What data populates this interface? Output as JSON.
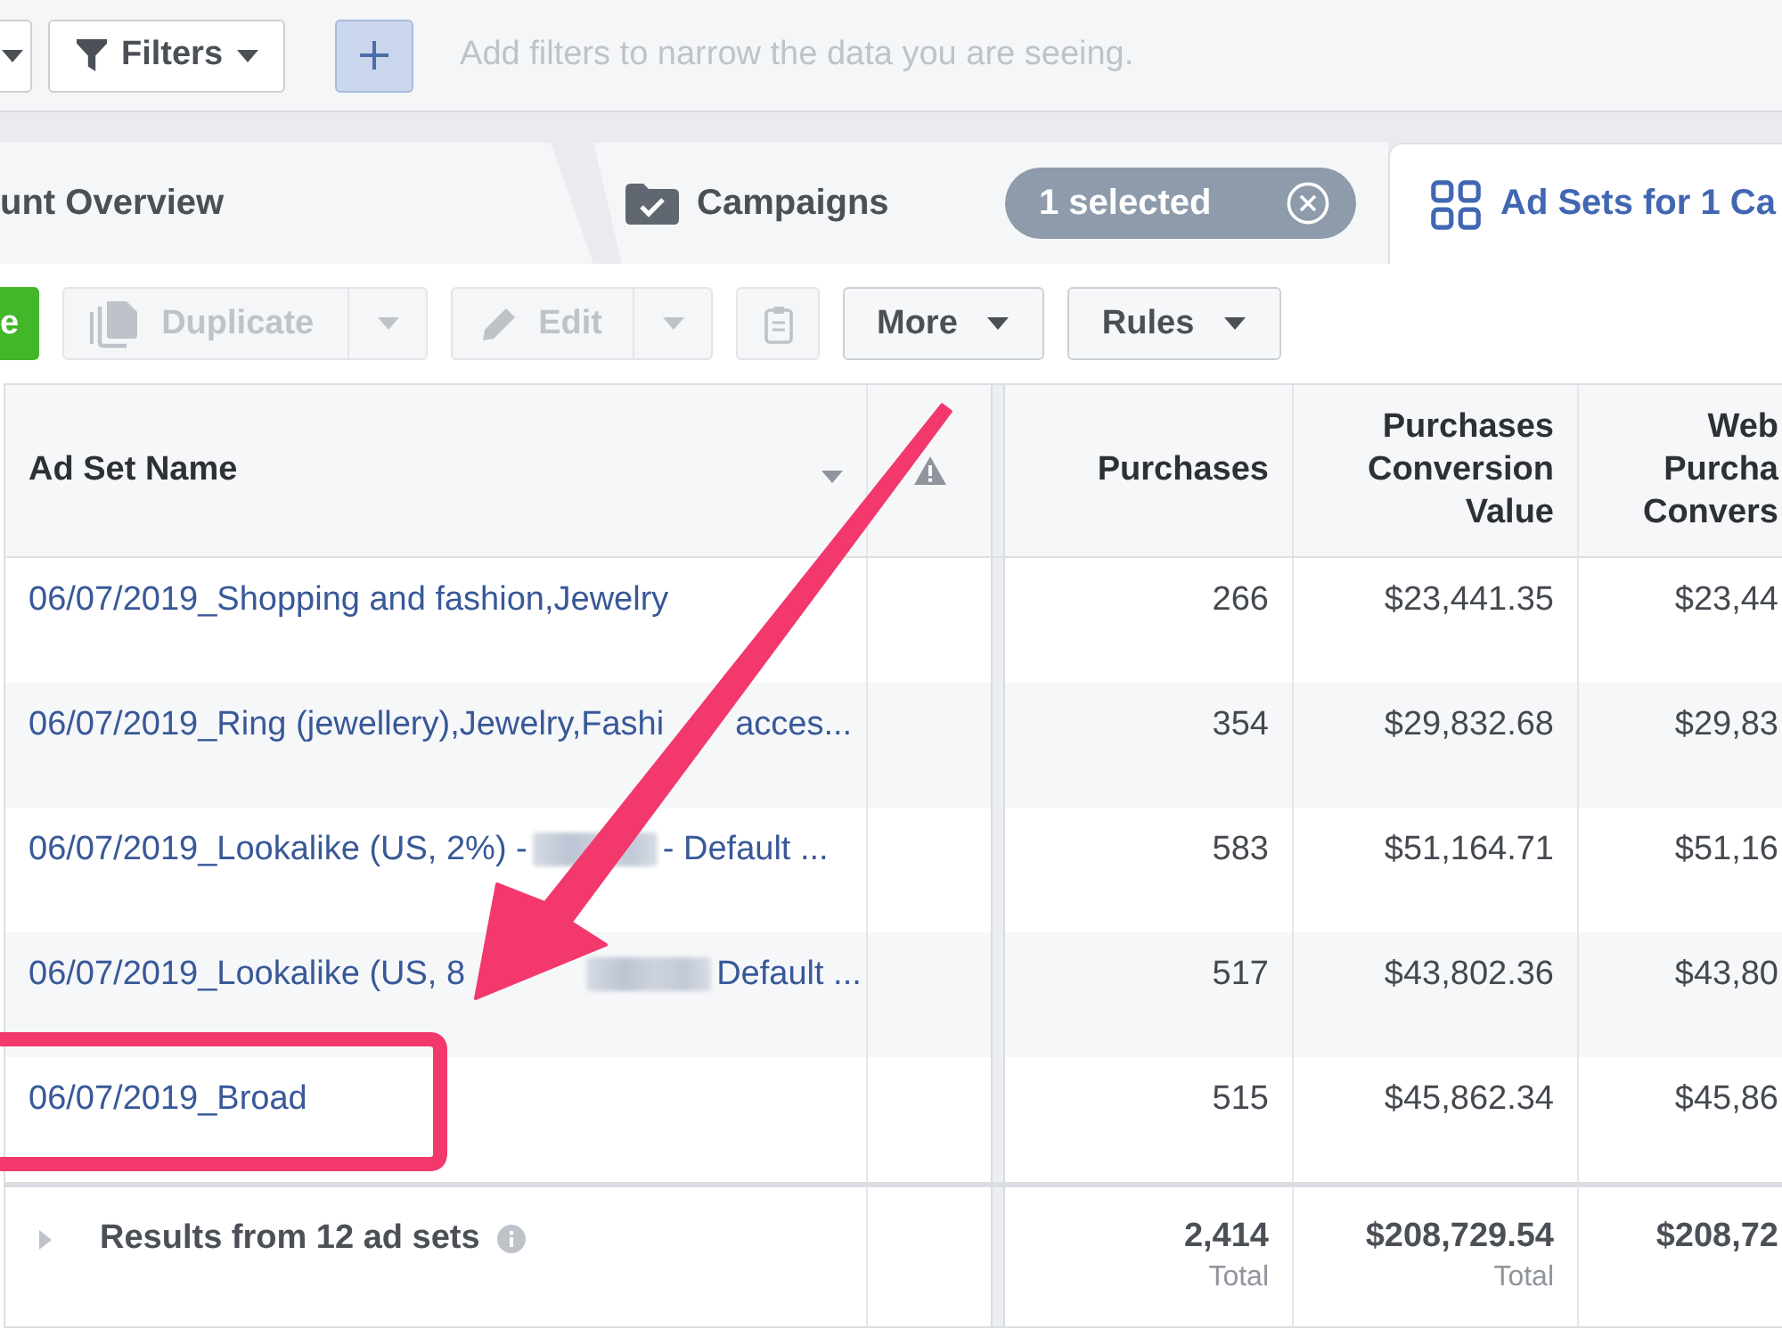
{
  "filter_bar": {
    "filters_button": {
      "label": "Filters"
    },
    "filter_input": {
      "placeholder": "Add filters to narrow the data you are seeing."
    }
  },
  "tabs": [
    {
      "kind": "overview",
      "label": "unt Overview",
      "selected": false
    },
    {
      "kind": "campaigns",
      "label": "Campaigns",
      "selected": false,
      "selection_chip": "1 selected"
    },
    {
      "kind": "ad_sets",
      "label": "Ad Sets for 1 Ca",
      "selected": true
    }
  ],
  "toolbar": {
    "buttons": [
      {
        "kind": "create",
        "label": "e",
        "disabled": false
      },
      {
        "kind": "duplicate",
        "label": "Duplicate",
        "disabled": true
      },
      {
        "kind": "edit",
        "label": "Edit",
        "disabled": true
      },
      {
        "kind": "clipboard",
        "disabled": true
      },
      {
        "kind": "dropdown",
        "label": "More",
        "disabled": false
      },
      {
        "kind": "dropdown",
        "label": "Rules",
        "disabled": false
      }
    ]
  },
  "table": {
    "columns": [
      {
        "kind": "name",
        "label": "Ad Set Name"
      },
      {
        "kind": "warning"
      },
      {
        "kind": "metric",
        "label": "Purchases"
      },
      {
        "kind": "metric",
        "label": "Purchases Conversion Value"
      },
      {
        "kind": "metric",
        "label": "Web Purcha Convers"
      }
    ],
    "rows": [
      {
        "name_parts": [
          {
            "kind": "text",
            "text": "06/07/2019_Shopping and fashion,Jewelry"
          }
        ],
        "metrics": [
          "266",
          "$23,441.35",
          "$23,44"
        ]
      },
      {
        "name_parts": [
          {
            "kind": "text",
            "text": "06/07/2019_Ring (jewellery),Jewelry,Fashi"
          },
          {
            "kind": "covered_shaft"
          },
          {
            "kind": "text",
            "text": "acces..."
          }
        ],
        "metrics": [
          "354",
          "$29,832.68",
          "$29,83"
        ]
      },
      {
        "name_parts": [
          {
            "kind": "text",
            "text": "06/07/2019_Lookalike (US, 2%) -"
          },
          {
            "kind": "redacted"
          },
          {
            "kind": "text",
            "text": "- Default ..."
          }
        ],
        "metrics": [
          "583",
          "$51,164.71",
          "$51,16"
        ]
      },
      {
        "name_parts": [
          {
            "kind": "text",
            "text": "06/07/2019_Lookalike (US, 8"
          },
          {
            "kind": "covered_head"
          },
          {
            "kind": "redacted"
          },
          {
            "kind": "text",
            "text": "Default ..."
          }
        ],
        "metrics": [
          "517",
          "$43,802.36",
          "$43,80"
        ]
      },
      {
        "name_parts": [
          {
            "kind": "text",
            "text": "06/07/2019_Broad"
          }
        ],
        "metrics": [
          "515",
          "$45,862.34",
          "$45,86"
        ]
      }
    ],
    "footer": {
      "label": "Results from 12 ad sets",
      "totals": [
        {
          "value": "2,414",
          "caption": "Total"
        },
        {
          "value": "$208,729.54",
          "caption": "Total"
        },
        {
          "value": "$208,72"
        }
      ]
    }
  }
}
